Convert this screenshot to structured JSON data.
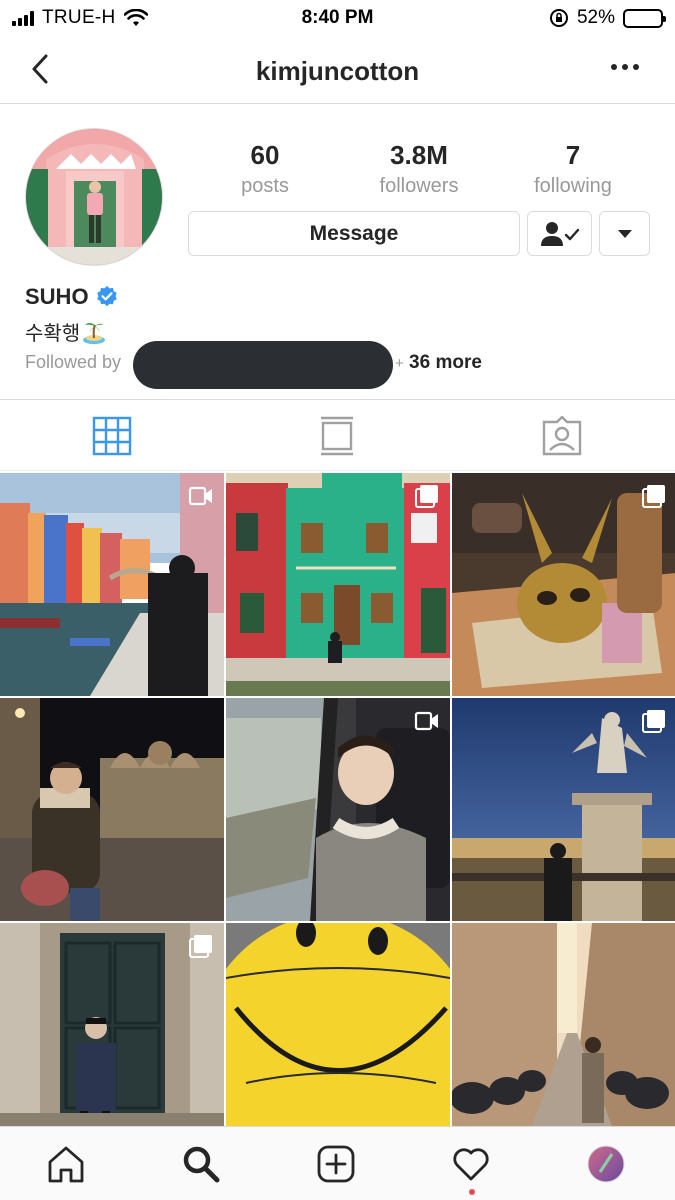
{
  "status_bar": {
    "carrier": "TRUE-H",
    "time": "8:40 PM",
    "battery": "52%",
    "battery_level": 0.52
  },
  "header": {
    "username": "kimjuncotton"
  },
  "profile": {
    "display_name": "SUHO",
    "bio": "수확행",
    "bio_emoji": "🏝️",
    "verified": true,
    "stats": [
      {
        "value": "60",
        "label": "posts"
      },
      {
        "value": "3.8M",
        "label": "followers"
      },
      {
        "value": "7",
        "label": "following"
      }
    ],
    "message_button": "Message",
    "followed_by_prefix": "Followed by",
    "followed_by_plus": "+",
    "followed_by_more": "36 more"
  },
  "tabs": [
    {
      "icon": "grid-icon",
      "active": true
    },
    {
      "icon": "feed-icon",
      "active": false
    },
    {
      "icon": "tagged-icon",
      "active": false
    }
  ],
  "posts": [
    {
      "scene": "venice-canal",
      "badge": "video-icon"
    },
    {
      "scene": "burano-houses",
      "badge": "carousel-icon"
    },
    {
      "scene": "gold-mask",
      "badge": "carousel-icon"
    },
    {
      "scene": "piazza-night",
      "badge": "none"
    },
    {
      "scene": "train-window",
      "badge": "video-icon"
    },
    {
      "scene": "angel-statue",
      "badge": "carousel-icon"
    },
    {
      "scene": "old-door",
      "badge": "carousel-icon"
    },
    {
      "scene": "smiley-ball",
      "badge": "none"
    },
    {
      "scene": "narrow-street",
      "badge": "none"
    }
  ],
  "bottom_nav": [
    "home-icon",
    "search-icon",
    "new-post-icon",
    "activity-icon",
    "profile-avatar"
  ],
  "colors": {
    "accent": "#3897f0",
    "verified": "#3897f0",
    "notification_dot": "#ed4956",
    "muted_text": "#999999"
  }
}
